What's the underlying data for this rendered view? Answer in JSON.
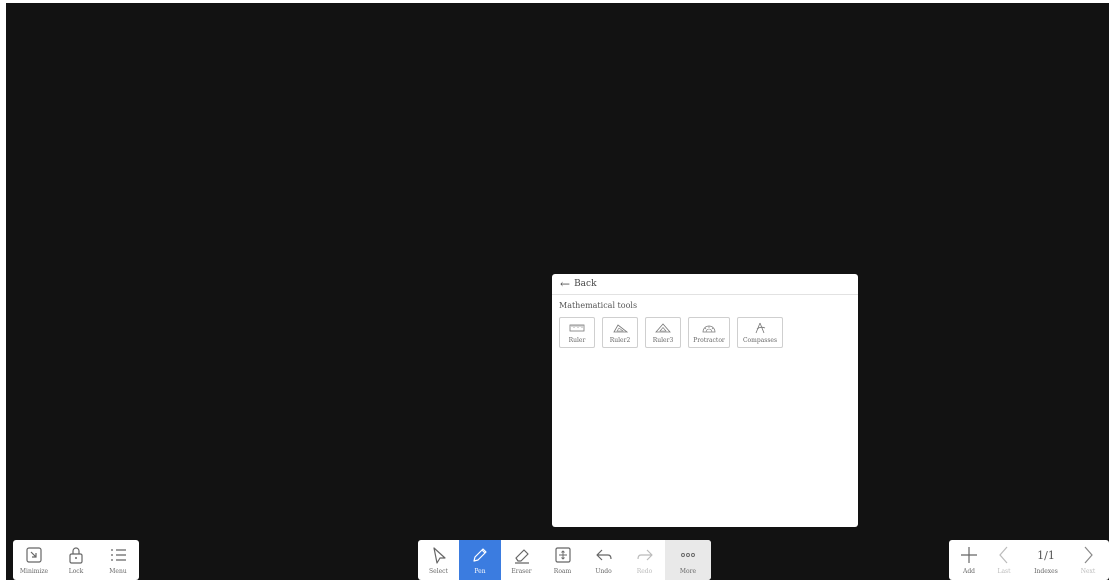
{
  "panel": {
    "back_label": "Back",
    "title": "Mathematical tools",
    "tools": [
      {
        "label": "Ruler",
        "icon": "ruler-icon"
      },
      {
        "label": "Ruler2",
        "icon": "triangle-ruler-icon"
      },
      {
        "label": "Ruler3",
        "icon": "isosceles-ruler-icon"
      },
      {
        "label": "Protractor",
        "icon": "protractor-icon"
      },
      {
        "label": "Compasses",
        "icon": "compasses-icon"
      }
    ]
  },
  "left_bar": {
    "minimize": "Minimize",
    "lock": "Lock",
    "menu": "Menu"
  },
  "center_bar": {
    "select": "Select",
    "pen": "Pen",
    "eraser": "Eraser",
    "roam": "Roam",
    "undo": "Undo",
    "redo": "Redo",
    "more": "More"
  },
  "right_bar": {
    "add": "Add",
    "last": "Last",
    "page": "1/1",
    "indexes": "Indexes",
    "next": "Next"
  },
  "colors": {
    "canvas": "#121212",
    "active": "#3b7ce0"
  }
}
